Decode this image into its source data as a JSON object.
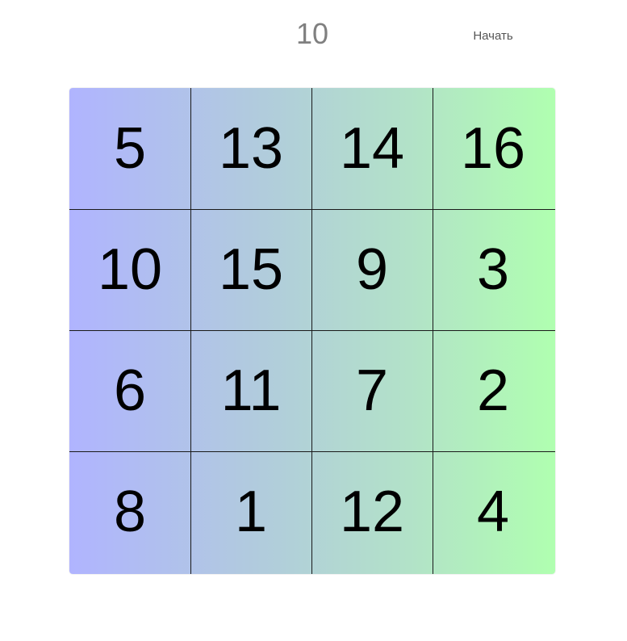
{
  "header": {
    "move_count": "10",
    "start_label": "Начать"
  },
  "board": {
    "colors": {
      "left": "#b0b4ff",
      "right": "#b0ffb0",
      "line": "#1a1a1a"
    },
    "rows": [
      [
        "5",
        "13",
        "14",
        "16"
      ],
      [
        "10",
        "15",
        "9",
        "3"
      ],
      [
        "6",
        "11",
        "7",
        "2"
      ],
      [
        "8",
        "1",
        "12",
        "4"
      ]
    ]
  }
}
